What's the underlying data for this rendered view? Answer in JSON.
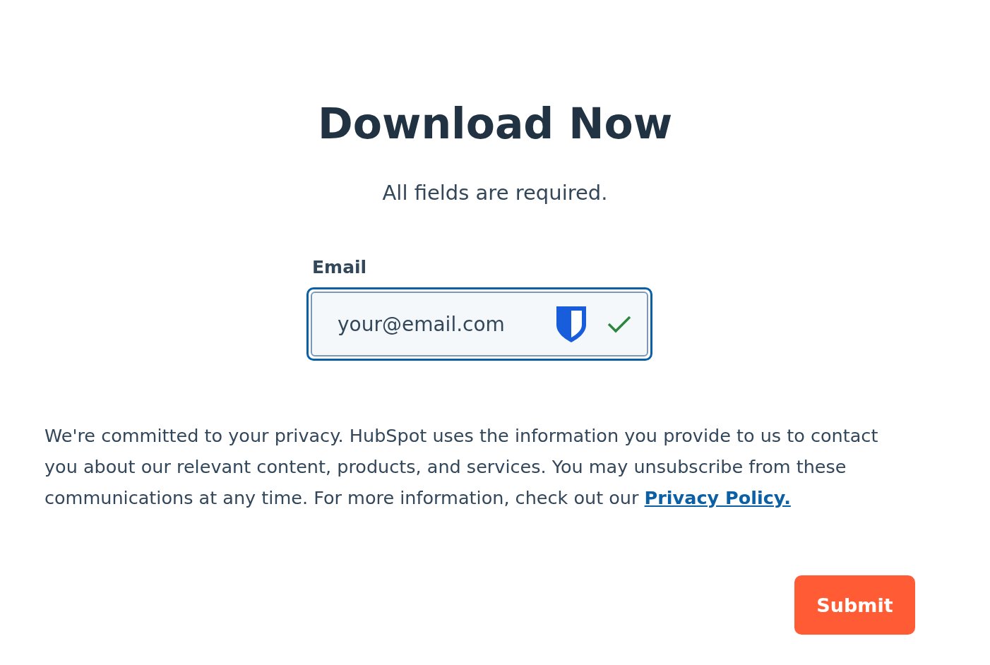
{
  "heading": "Download Now",
  "subtitle": "All fields are required.",
  "email_field": {
    "label": "Email",
    "value": "your@email.com",
    "valid": true
  },
  "privacy_notice": {
    "text": "We're committed to your privacy. HubSpot uses the information you provide to us to contact you about our relevant content, products, and services. You may unsubscribe from these communications at any time. For more information, check out our",
    "link": "Privacy Policy."
  },
  "submit_button": "Submit"
}
